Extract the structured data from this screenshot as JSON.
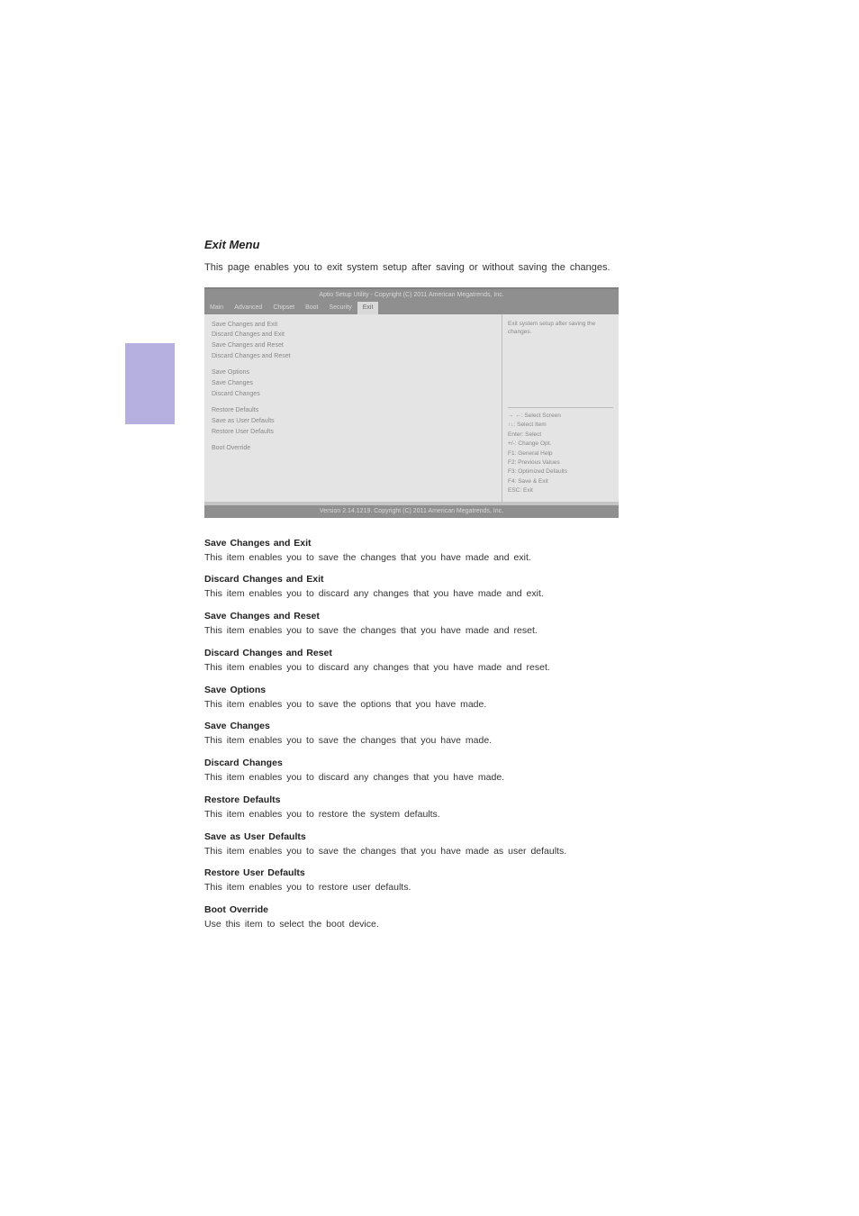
{
  "page": {
    "title": "Exit Menu",
    "intro": "This page enables you to exit system setup after saving or without saving the changes."
  },
  "bios": {
    "header": "Aptio Setup Utility - Copyright (C) 2011 American Megatrends, Inc.",
    "tabs": [
      "Main",
      "Advanced",
      "Chipset",
      "Boot",
      "Security",
      "Exit"
    ],
    "active_tab": 5,
    "left_items_a": [
      "Save Changes and Exit",
      "Discard Changes and Exit",
      "Save Changes and Reset",
      "Discard Changes and Reset"
    ],
    "left_heading_b": "Save Options",
    "left_items_b": [
      "Save Changes",
      "Discard Changes"
    ],
    "left_items_c": [
      "Restore Defaults",
      "Save as User Defaults",
      "Restore User Defaults"
    ],
    "left_heading_d": "Boot Override",
    "right_desc": "Exit system setup after saving the changes.",
    "help": {
      "l1_key": "→ ←",
      "l1_val": ": Select Screen",
      "l2_key": "↑↓",
      "l2_val": ": Select Item",
      "l3_key": "Enter",
      "l3_val": ": Select",
      "l4_key": "+/-",
      "l4_val": ": Change Opt.",
      "l5_key": "F1",
      "l5_val": ": General Help",
      "l6_key": "F2",
      "l6_val": ": Previous Values",
      "l7_key": "F3",
      "l7_val": ": Optimized Defaults",
      "l8_key": "F4",
      "l8_val": ": Save & Exit",
      "l9_key": "ESC",
      "l9_val": ": Exit"
    },
    "footer": "Version 2.14.1219. Copyright (C) 2011 American Megatrends, Inc."
  },
  "defs": [
    {
      "title": "Save Changes and Exit",
      "body": "This item enables you to save the changes that you have made and exit."
    },
    {
      "title": "Discard Changes and Exit",
      "body": "This item enables you to discard any changes that you have made and exit."
    },
    {
      "title": "Save Changes and Reset",
      "body": "This item enables you to save the changes that you have made and reset."
    },
    {
      "title": "Discard Changes and Reset",
      "body": "This item enables you to discard any changes that you have made and reset."
    },
    {
      "title": "Save Options",
      "body": "This item enables you to save the options that you have made."
    },
    {
      "title": "Save Changes",
      "body": "This item enables you to save the changes that you have made."
    },
    {
      "title": "Discard Changes",
      "body": "This item enables you to discard any changes that you have made."
    },
    {
      "title": "Restore Defaults",
      "body": "This item enables you to restore the system defaults."
    },
    {
      "title": "Save as User Defaults",
      "body": "This item enables you to save the changes that you have made as user defaults."
    },
    {
      "title": "Restore User Defaults",
      "body": "This item enables you to restore user defaults."
    },
    {
      "title": "Boot Override",
      "body": "Use this item to select the boot device."
    }
  ]
}
